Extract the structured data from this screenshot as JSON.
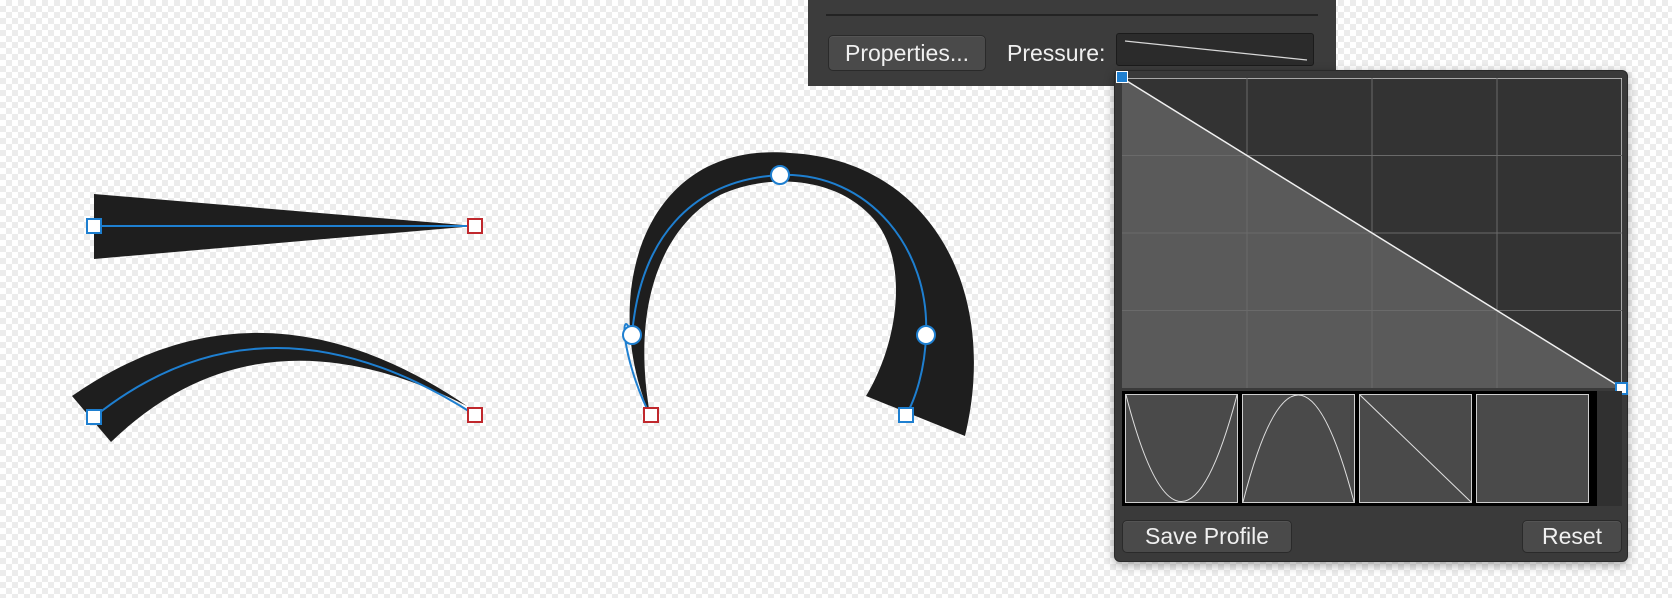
{
  "toolbar": {
    "properties_label": "Properties...",
    "pressure_label": "Pressure:"
  },
  "pressure_popup": {
    "save_profile_label": "Save Profile",
    "reset_label": "Reset",
    "graph": {
      "grid_columns": 4,
      "grid_rows": 4,
      "curve_points": [
        [
          0,
          1
        ],
        [
          1,
          0
        ]
      ],
      "selected_node": "start"
    },
    "presets": [
      {
        "name": "valley-curve"
      },
      {
        "name": "bell-curve"
      },
      {
        "name": "linear-descending"
      },
      {
        "name": "empty"
      }
    ]
  },
  "colors": {
    "stroke_fill": "#1e1e1e",
    "path_line": "#1e7fd0",
    "end_node": "#c0282d",
    "panel_bg": "#3c3c3c"
  }
}
